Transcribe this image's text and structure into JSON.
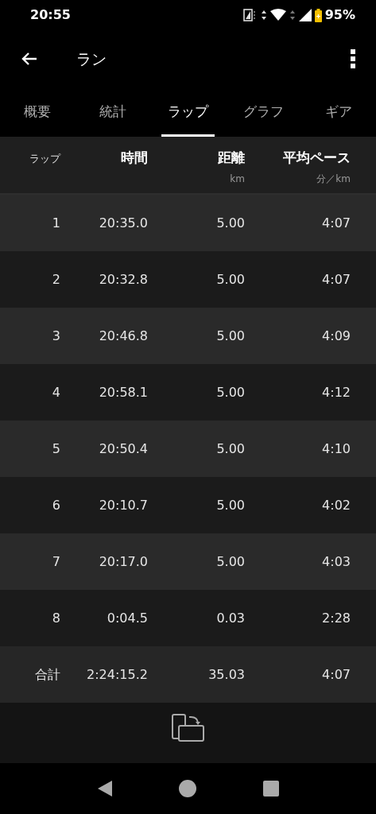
{
  "status_bar": {
    "time": "20:55",
    "battery": "95%"
  },
  "app_bar": {
    "title": "ラン"
  },
  "tabs": [
    {
      "label": "概要",
      "selected": false
    },
    {
      "label": "統計",
      "selected": false
    },
    {
      "label": "ラップ",
      "selected": true
    },
    {
      "label": "グラフ",
      "selected": false
    },
    {
      "label": "ギア",
      "selected": false
    }
  ],
  "table": {
    "columns": [
      {
        "label": "ラップ"
      },
      {
        "label": "時間"
      },
      {
        "label": "距離",
        "unit": "km"
      },
      {
        "label": "平均ペース",
        "unit": "分／km"
      }
    ],
    "rows": [
      {
        "lap": "1",
        "time": "20:35.0",
        "distance": "5.00",
        "pace": "4:07"
      },
      {
        "lap": "2",
        "time": "20:32.8",
        "distance": "5.00",
        "pace": "4:07"
      },
      {
        "lap": "3",
        "time": "20:46.8",
        "distance": "5.00",
        "pace": "4:09"
      },
      {
        "lap": "4",
        "time": "20:58.1",
        "distance": "5.00",
        "pace": "4:12"
      },
      {
        "lap": "5",
        "time": "20:50.4",
        "distance": "5.00",
        "pace": "4:10"
      },
      {
        "lap": "6",
        "time": "20:10.7",
        "distance": "5.00",
        "pace": "4:02"
      },
      {
        "lap": "7",
        "time": "20:17.0",
        "distance": "5.00",
        "pace": "4:03"
      },
      {
        "lap": "8",
        "time": "0:04.5",
        "distance": "0.03",
        "pace": "2:28"
      }
    ],
    "total": {
      "lap": "合計",
      "time": "2:24:15.2",
      "distance": "35.03",
      "pace": "4:07"
    }
  }
}
